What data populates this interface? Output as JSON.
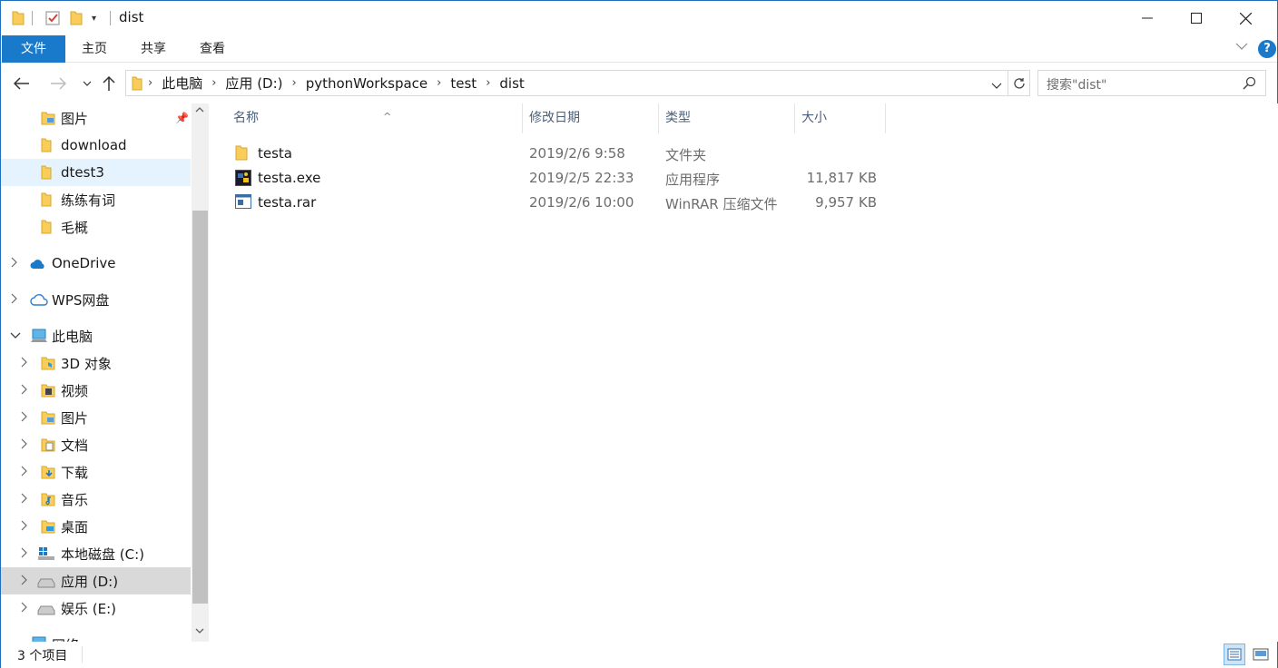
{
  "window": {
    "title": "dist",
    "controls": {
      "minimize": "—",
      "maximize": "☐",
      "close": "✕"
    }
  },
  "ribbon": {
    "tabs": [
      "文件",
      "主页",
      "共享",
      "查看"
    ],
    "help": "?"
  },
  "address": {
    "breadcrumbs": [
      "此电脑",
      "应用 (D:)",
      "pythonWorkspace",
      "test",
      "dist"
    ],
    "search_placeholder": "搜索\"dist\""
  },
  "nav": {
    "quick_access": [
      "图片",
      "download",
      "dtest3",
      "练练有词",
      "毛概"
    ],
    "onedrive": "OneDrive",
    "wps": "WPS网盘",
    "this_pc": "此电脑",
    "pc_items": [
      "3D 对象",
      "视频",
      "图片",
      "文档",
      "下载",
      "音乐",
      "桌面",
      "本地磁盘 (C:)",
      "应用 (D:)",
      "娱乐 (E:)"
    ],
    "network": "网络"
  },
  "columns": {
    "name": "名称",
    "modified": "修改日期",
    "type": "类型",
    "size": "大小"
  },
  "files": [
    {
      "name": "testa",
      "modified": "2019/2/6 9:58",
      "type": "文件夹",
      "size": "",
      "icon": "folder-icon"
    },
    {
      "name": "testa.exe",
      "modified": "2019/2/5 22:33",
      "type": "应用程序",
      "size": "11,817 KB",
      "icon": "exe-icon"
    },
    {
      "name": "testa.rar",
      "modified": "2019/2/6 10:00",
      "type": "WinRAR 压缩文件",
      "size": "9,957 KB",
      "icon": "rar-icon"
    }
  ],
  "status": {
    "item_count": "3 个项目"
  },
  "colors": {
    "accent": "#1979ca",
    "folder": "#f8cd5c",
    "selected": "#e5f3ff",
    "hover": "#d9d9d9"
  }
}
